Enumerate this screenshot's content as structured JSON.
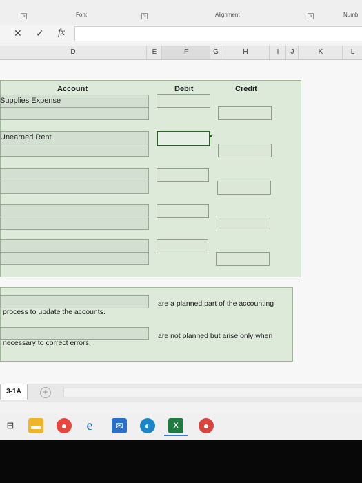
{
  "ribbon": {
    "font_label": "Font",
    "alignment_label": "Alignment",
    "number_label": "Numb"
  },
  "formula_bar": {
    "cancel_glyph": "✕",
    "enter_glyph": "✓",
    "fx_glyph": "fx",
    "value": ""
  },
  "columns": [
    "D",
    "E",
    "F",
    "G",
    "H",
    "I",
    "J",
    "K",
    "L"
  ],
  "journal": {
    "account_header": "Account",
    "debit_header": "Debit",
    "credit_header": "Credit",
    "row1_account": "Supplies Expense",
    "row2_account": "Unearned Rent"
  },
  "statements": {
    "line1_right": "are a planned part of the accounting",
    "line1_left": "process to update the accounts.",
    "line2_right": "are not planned but arise only when",
    "line2_left": "necessary to correct errors."
  },
  "sheet_tabs": {
    "active": "3-1A",
    "add": "+"
  },
  "colors": {
    "panel": "#dde9d9",
    "cell": "#d3dfd0",
    "accent_excel_green": "#1e7a3e"
  }
}
